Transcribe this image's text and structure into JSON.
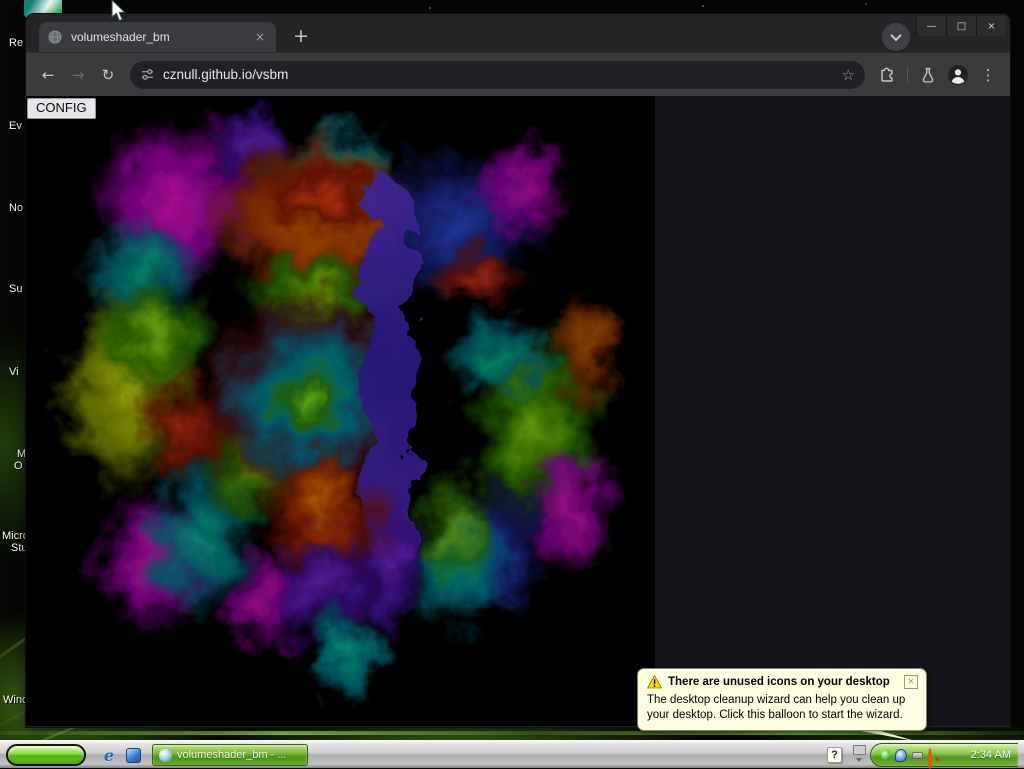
{
  "desktop": {
    "icon_label_fragments": [
      "Re",
      "Ev",
      "No",
      "Su",
      "Vi",
      "M",
      "O",
      "Micro",
      "Stu",
      "Wind"
    ],
    "wallpaper_accent": "#9fe040"
  },
  "browser": {
    "tab": {
      "title": "volumeshader_bm",
      "close_glyph": "×"
    },
    "new_tab_glyph": "+",
    "window_controls": {
      "minimize": "—",
      "maximize": "□",
      "close": "×"
    },
    "nav": {
      "back": "←",
      "forward": "→",
      "reload": "↻"
    },
    "omnibox": {
      "url": "cznull.github.io/vsbm",
      "bookmark_glyph": "☆"
    },
    "menu_glyph": "⋮"
  },
  "page": {
    "config_button": "CONFIG"
  },
  "notification": {
    "title": "There are unused icons on your desktop",
    "body": "The desktop cleanup wizard can help you clean up your desktop. Click this balloon to start the wizard.",
    "close_glyph": "×"
  },
  "taskbar": {
    "task_button": "volumeshader_bm - ...",
    "help_glyph": "?",
    "clock": "2:34 AM"
  },
  "icons": {
    "tab_favicon": "gray-globe",
    "tab_search": "chevron-down",
    "site_settings": "tune-sliders",
    "bookmark": "star-outline",
    "extensions": "puzzle-piece",
    "labs": "beaker-flask",
    "profile": "person-avatar",
    "menu": "three-dots-vertical",
    "warning": "yellow-triangle-exclamation",
    "quick_launch": [
      "internet-explorer-e",
      "blue-app-window"
    ],
    "tray": [
      "green-status",
      "cleanup-balloon",
      "gray-device",
      "orange-magnifier"
    ],
    "cursor": "white-arrow-pointer"
  },
  "colors": {
    "taskbar_green": "#76b437",
    "tray_green": "#6fae31",
    "balloon_bg": "#ffffe1",
    "toolbar": "#3a3b3d",
    "tabstrip": "#232426",
    "omnibox": "#202124",
    "page_panel": "#141418",
    "canvas": "#000000"
  }
}
